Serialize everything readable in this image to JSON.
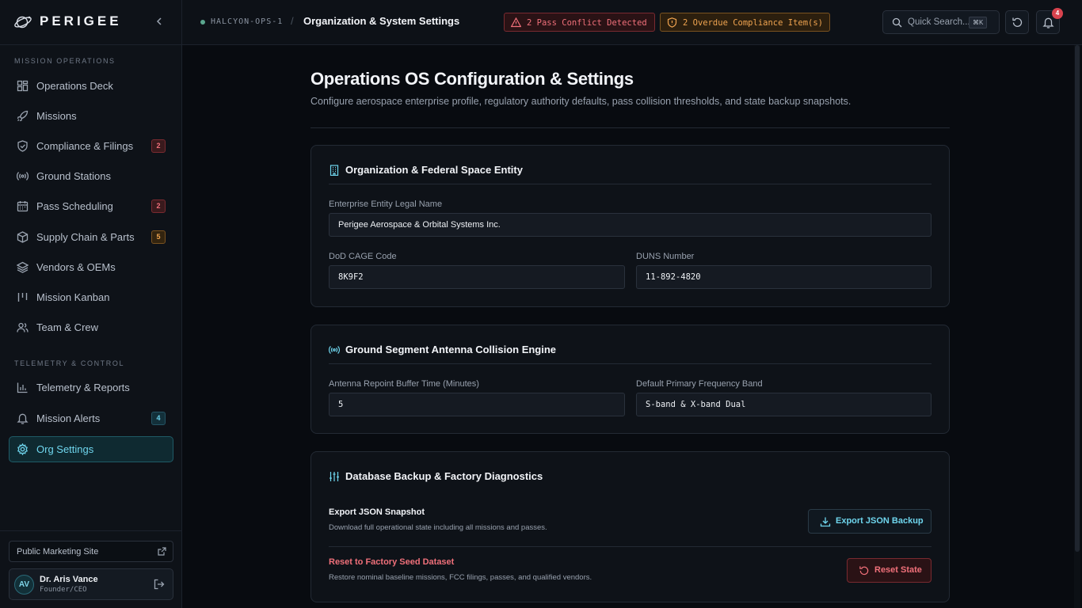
{
  "brand": {
    "name": "PERIGEE",
    "logo_icon": "orbit-icon"
  },
  "sidebar": {
    "section_mission": "MISSION OPERATIONS",
    "section_telemetry": "TELEMETRY & CONTROL",
    "items": [
      {
        "label": "Operations Deck",
        "icon": "dashboard-icon"
      },
      {
        "label": "Missions",
        "icon": "rocket-icon"
      },
      {
        "label": "Compliance & Filings",
        "icon": "shield-icon",
        "badge": "2"
      },
      {
        "label": "Ground Stations",
        "icon": "antenna-icon"
      },
      {
        "label": "Pass Scheduling",
        "icon": "calendar-icon",
        "badge": "2"
      },
      {
        "label": "Supply Chain & Parts",
        "icon": "package-icon",
        "badge": "5"
      },
      {
        "label": "Vendors & OEMs",
        "icon": "layers-icon"
      },
      {
        "label": "Mission Kanban",
        "icon": "kanban-icon"
      },
      {
        "label": "Team & Crew",
        "icon": "users-icon"
      },
      {
        "label": "Telemetry & Reports",
        "icon": "bar-chart-icon"
      },
      {
        "label": "Mission Alerts",
        "icon": "bell-icon",
        "badge": "4"
      },
      {
        "label": "Org Settings",
        "icon": "gear-icon",
        "active": true
      }
    ],
    "marketing_link": "Public Marketing Site",
    "user": {
      "initials": "AV",
      "name": "Dr. Aris Vance",
      "role": "Founder/CEO"
    }
  },
  "header": {
    "environment": "HALCYON-OPS-1",
    "separator": "/",
    "title": "Organization & System Settings",
    "alert_conflict": "2 Pass Conflict Detected",
    "alert_compliance": "2 Overdue Compliance Item(s)",
    "search_label": "Quick Search...",
    "search_shortcut": "⌘K",
    "notification_count": "4"
  },
  "page": {
    "title": "Operations OS Configuration & Settings",
    "subtitle": "Configure aerospace enterprise profile, regulatory authority defaults, pass collision thresholds, and state backup snapshots."
  },
  "org_card": {
    "title": "Organization & Federal Space Entity",
    "legal_name_label": "Enterprise Entity Legal Name",
    "legal_name_value": "Perigee Aerospace & Orbital Systems Inc.",
    "cage_label": "DoD CAGE Code",
    "cage_value": "8K9F2",
    "duns_label": "DUNS Number",
    "duns_value": "11-892-4820"
  },
  "ground_card": {
    "title": "Ground Segment Antenna Collision Engine",
    "buffer_label": "Antenna Repoint Buffer Time (Minutes)",
    "buffer_value": "5",
    "band_label": "Default Primary Frequency Band",
    "band_value": "S-band & X-band Dual"
  },
  "backup_card": {
    "title": "Database Backup & Factory Diagnostics",
    "export_title": "Export JSON Snapshot",
    "export_desc": "Download full operational state including all missions and passes.",
    "export_button": "Export JSON Backup",
    "reset_title": "Reset to Factory Seed Dataset",
    "reset_desc": "Restore nominal baseline missions, FCC filings, passes, and qualified vendors.",
    "reset_button": "Reset State"
  },
  "colors": {
    "accent": "#6fd6ee",
    "danger": "#f0707a",
    "warning": "#f0a450",
    "background": "#080b10",
    "surface": "#0e1218"
  }
}
